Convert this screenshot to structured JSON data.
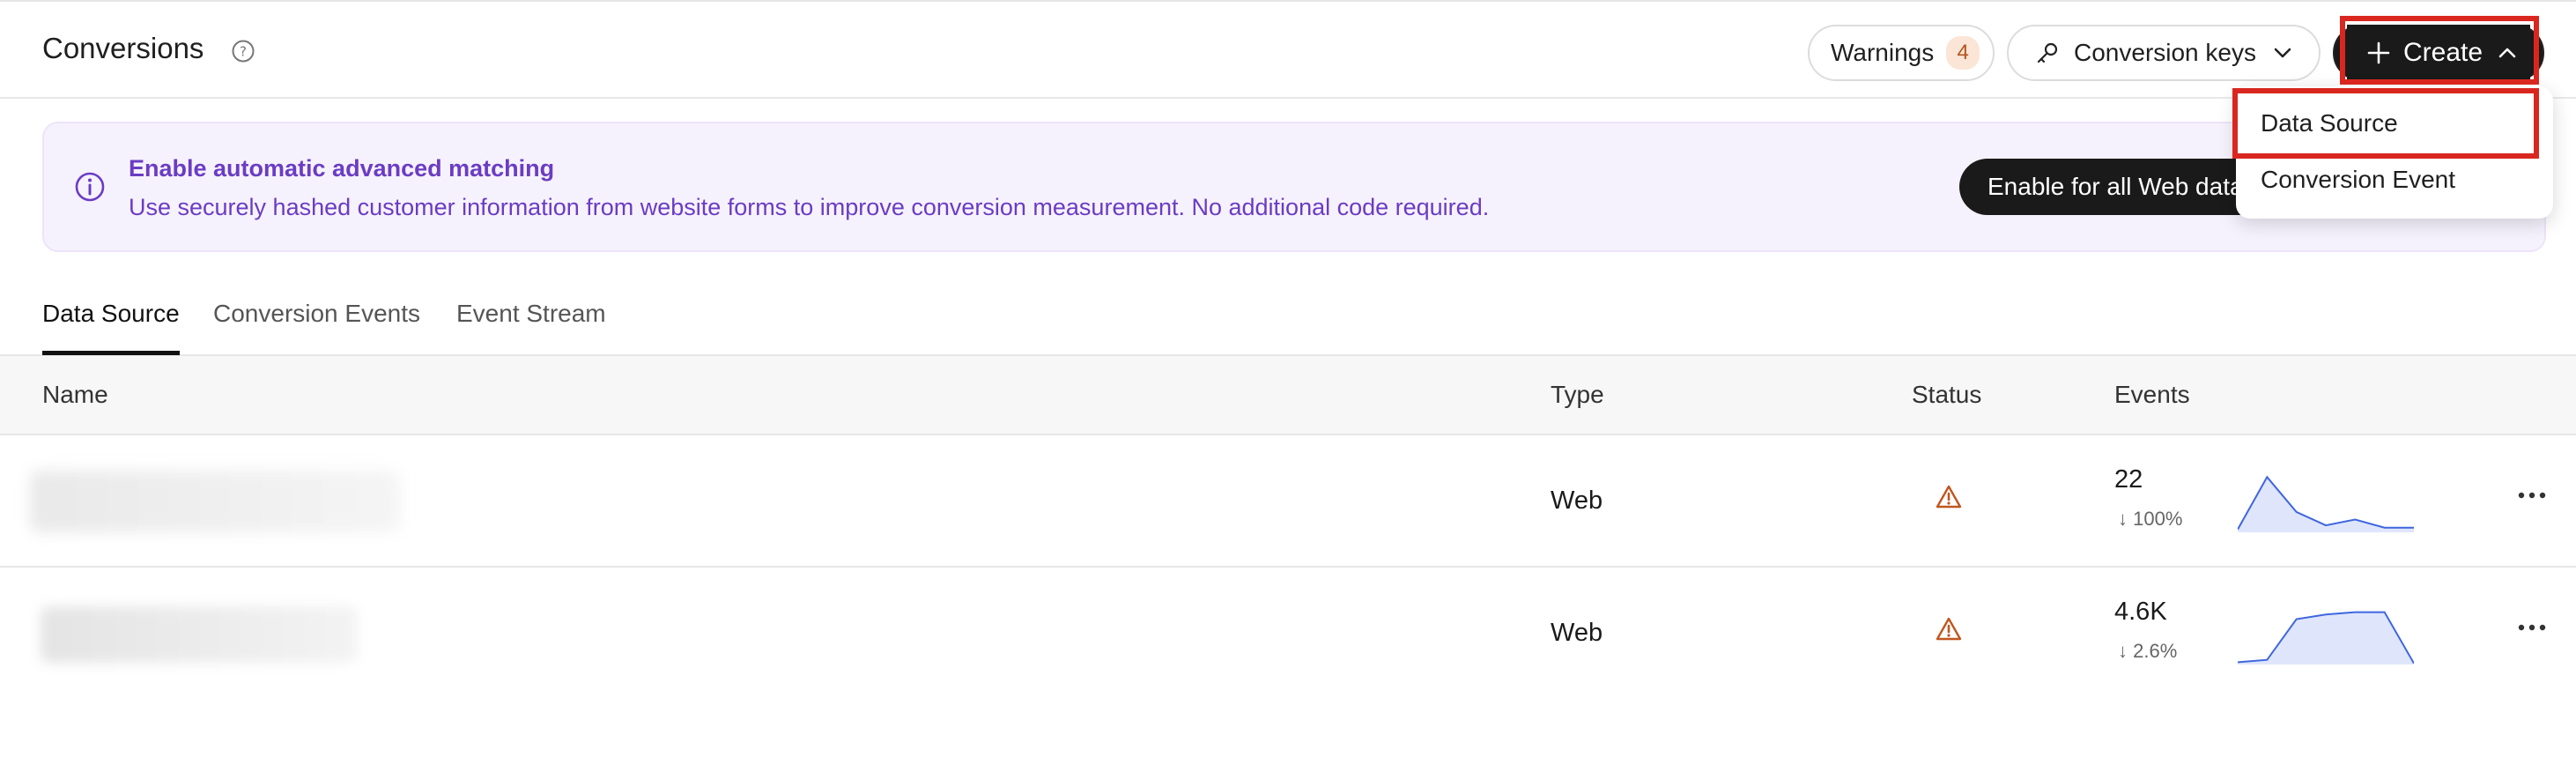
{
  "header": {
    "title": "Conversions",
    "warnings_label": "Warnings",
    "warnings_count": "4",
    "conversion_keys_label": "Conversion keys",
    "create_label": "Create"
  },
  "create_menu": {
    "items": [
      {
        "label": "Data Source"
      },
      {
        "label": "Conversion Event"
      }
    ]
  },
  "banner": {
    "title": "Enable automatic advanced matching",
    "description": "Use securely hashed customer information from website forms to improve conversion measurement. No additional code required.",
    "button_label": "Enable for all Web data"
  },
  "tabs": [
    {
      "label": "Data Source",
      "active": true
    },
    {
      "label": "Conversion Events",
      "active": false
    },
    {
      "label": "Event Stream",
      "active": false
    }
  ],
  "table": {
    "columns": [
      "Name",
      "Type",
      "Status",
      "Events"
    ],
    "rows": [
      {
        "type": "Web",
        "status": "warning-icon",
        "events": "22",
        "change": "↓ 100%",
        "trend": [
          0.05,
          0.95,
          0.35,
          0.12,
          0.22,
          0.08,
          0.08
        ]
      },
      {
        "type": "Web",
        "status": "warning-icon",
        "events": "4.6K",
        "change": "↓ 2.6%",
        "trend": [
          0.04,
          0.08,
          0.78,
          0.86,
          0.9,
          0.9,
          0.02
        ]
      }
    ]
  },
  "colors": {
    "accent_purple": "#6b3cc4",
    "banner_bg": "#f6f2fd",
    "warning": "#c0561f",
    "highlight_red": "#d9271f",
    "spark_line": "#3f66e0"
  }
}
